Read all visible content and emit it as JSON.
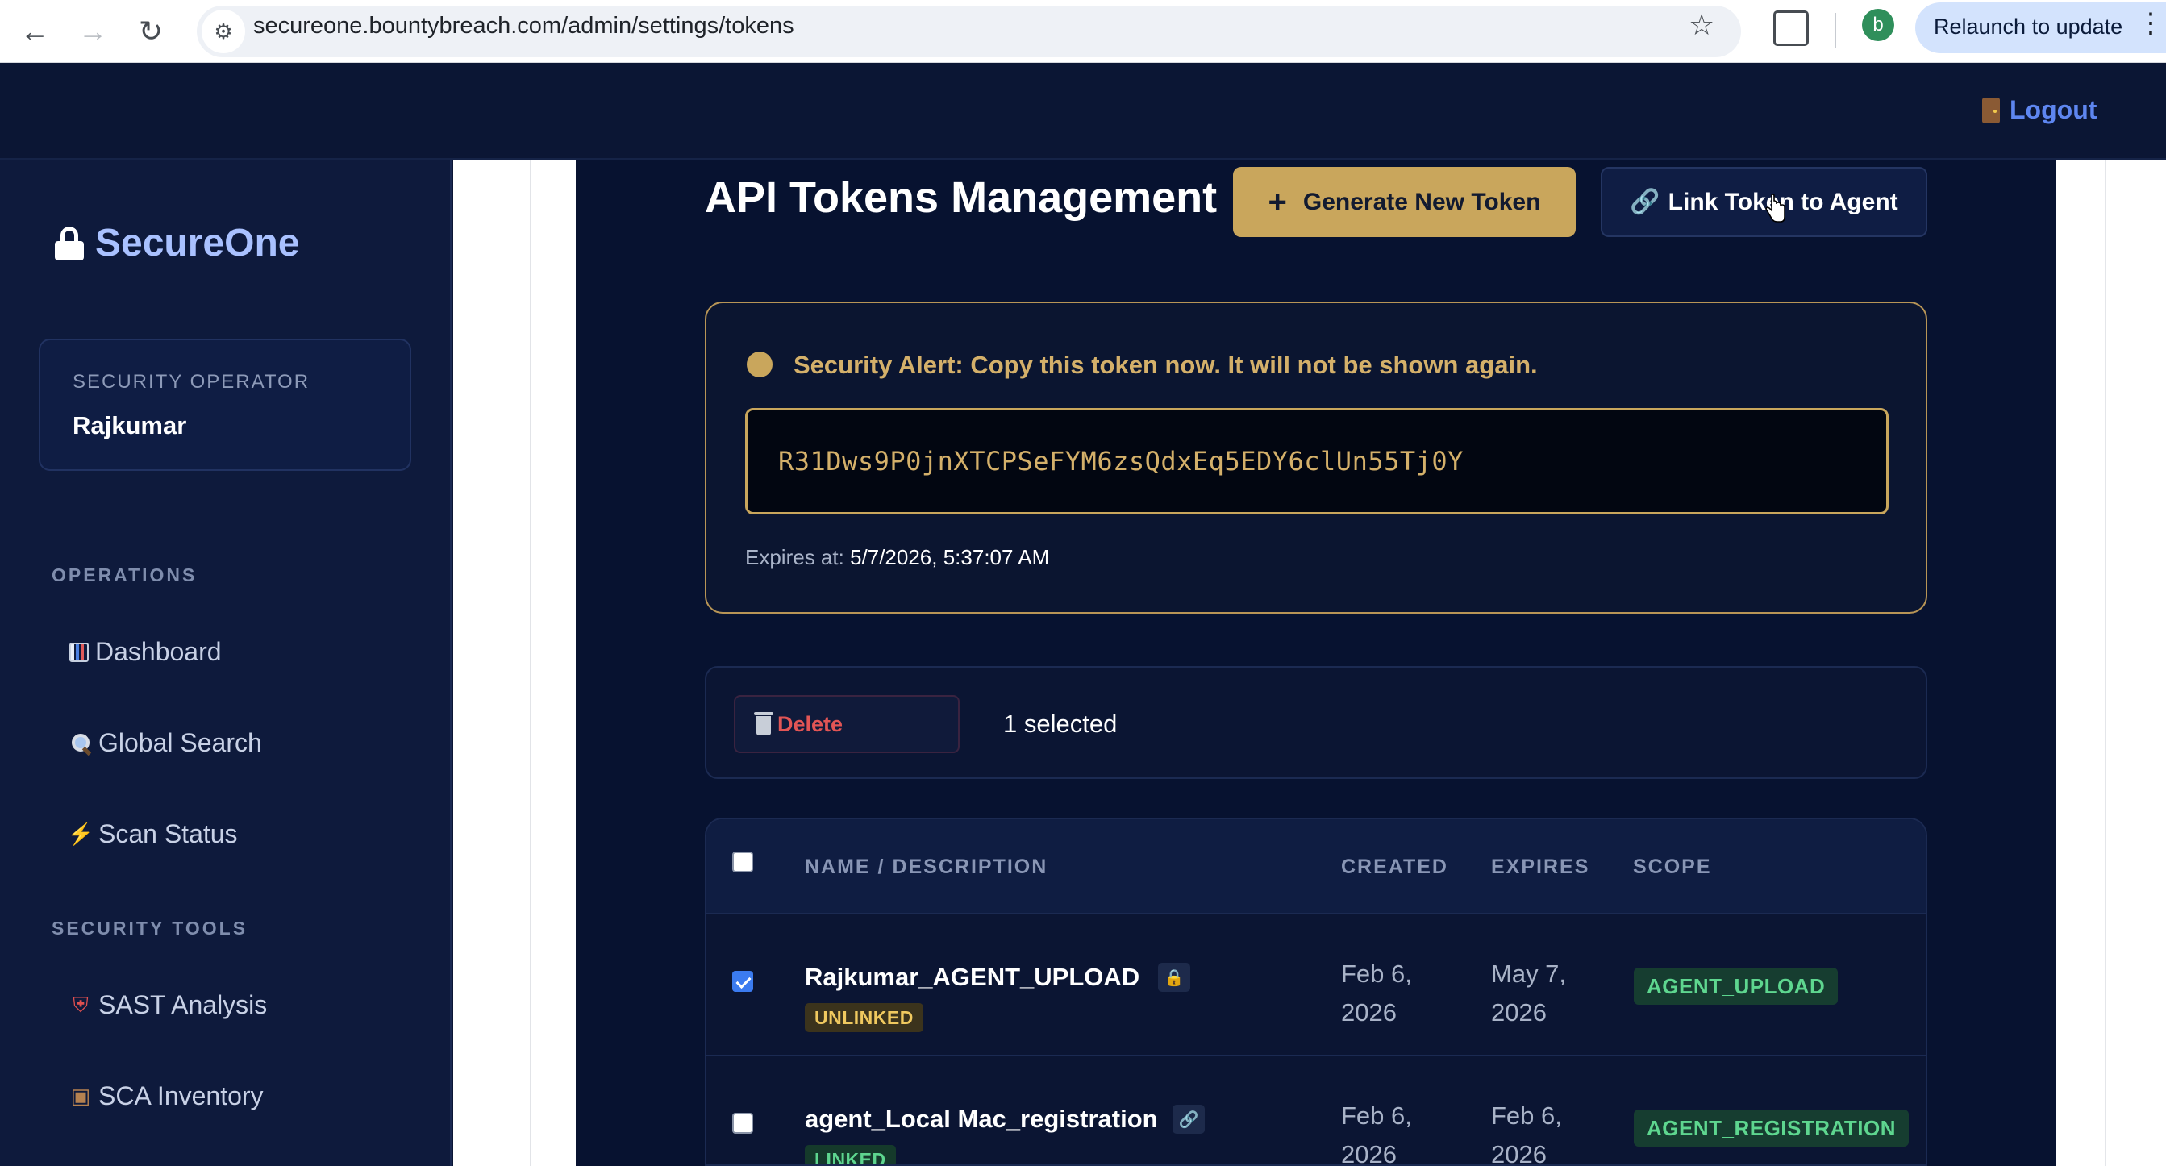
{
  "browser": {
    "url": "secureone.bountybreach.com/admin/settings/tokens",
    "profile_initial": "b",
    "relaunch_label": "Relaunch to update"
  },
  "topbar": {
    "logout_label": "Logout"
  },
  "sidebar": {
    "brand": "SecureOne",
    "operator_role": "SECURITY OPERATOR",
    "operator_name": "Rajkumar",
    "sections": [
      {
        "label": "OPERATIONS",
        "items": [
          {
            "icon": "bar-chart-icon",
            "label": "Dashboard"
          },
          {
            "icon": "magnifier-icon",
            "label": "Global Search"
          },
          {
            "icon": "lightning-icon",
            "label": "Scan Status"
          }
        ]
      },
      {
        "label": "SECURITY TOOLS",
        "items": [
          {
            "icon": "shield-icon",
            "label": "SAST Analysis"
          },
          {
            "icon": "package-icon",
            "label": "SCA Inventory"
          }
        ]
      }
    ]
  },
  "main": {
    "title": "API Tokens Management",
    "generate_label": "Generate New Token",
    "link_label": "Link Token to Agent",
    "alert": {
      "message": "Security Alert: Copy this token now. It will not be shown again.",
      "token": "R31Dws9P0jnXTCPSeFYM6zsQdxEq5EDY6clUn55Tj0Y",
      "expires_label": "Expires at:",
      "expires_value": "5/7/2026, 5:37:07 AM"
    },
    "bulk": {
      "delete_label": "Delete",
      "selected_text": "1 selected"
    },
    "table": {
      "columns": [
        "NAME / DESCRIPTION",
        "CREATED",
        "EXPIRES",
        "SCOPE"
      ],
      "rows": [
        {
          "checked": true,
          "name": "Rajkumar_AGENT_UPLOAD",
          "icon": "lock-icon",
          "status": "UNLINKED",
          "created_1": "Feb 6,",
          "created_2": "2026",
          "expires_1": "May 7,",
          "expires_2": "2026",
          "scope": "AGENT_UPLOAD"
        },
        {
          "checked": false,
          "name": "agent_Local Mac_registration",
          "icon": "link-icon",
          "status": "LINKED",
          "created_1": "Feb 6,",
          "created_2": "2026",
          "expires_1": "Feb 6,",
          "expires_2": "2026",
          "scope": "AGENT_REGISTRATION"
        }
      ]
    }
  }
}
